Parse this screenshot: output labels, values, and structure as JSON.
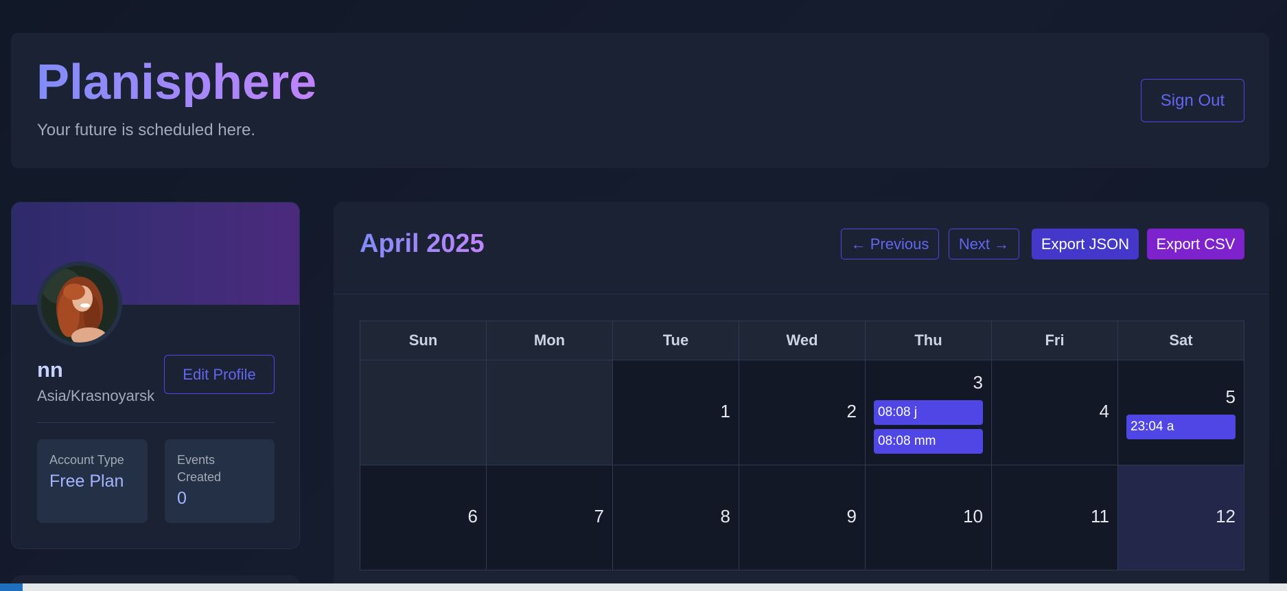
{
  "header": {
    "title": "Planisphere",
    "subtitle": "Your future is scheduled here.",
    "sign_out_label": "Sign Out"
  },
  "profile": {
    "name": "nn",
    "timezone": "Asia/Krasnoyarsk",
    "edit_label": "Edit Profile",
    "account_type_label": "Account Type",
    "account_type_value": "Free Plan",
    "events_created_label": "Events Created",
    "events_created_value": "0"
  },
  "calendar": {
    "month_title": "April 2025",
    "prev_label": "← Previous",
    "next_label": "Next →",
    "export_json_label": "Export JSON",
    "export_csv_label": "Export CSV",
    "weekdays": [
      "Sun",
      "Mon",
      "Tue",
      "Wed",
      "Thu",
      "Fri",
      "Sat"
    ],
    "week1": {
      "d1": "1",
      "d2": "2",
      "d3": "3",
      "d4": "4",
      "d5": "5",
      "events_d3": [
        "08:08 j",
        "08:08 mm"
      ],
      "events_d5": [
        "23:04 a"
      ]
    },
    "week2": {
      "d6": "6",
      "d7": "7",
      "d8": "8",
      "d9": "9",
      "d10": "10",
      "d11": "11",
      "d12": "12"
    }
  },
  "colors": {
    "accent": "#4f46e5",
    "accent_purple": "#7e22ce",
    "background": "#121826",
    "today_highlight": "#23284a"
  }
}
